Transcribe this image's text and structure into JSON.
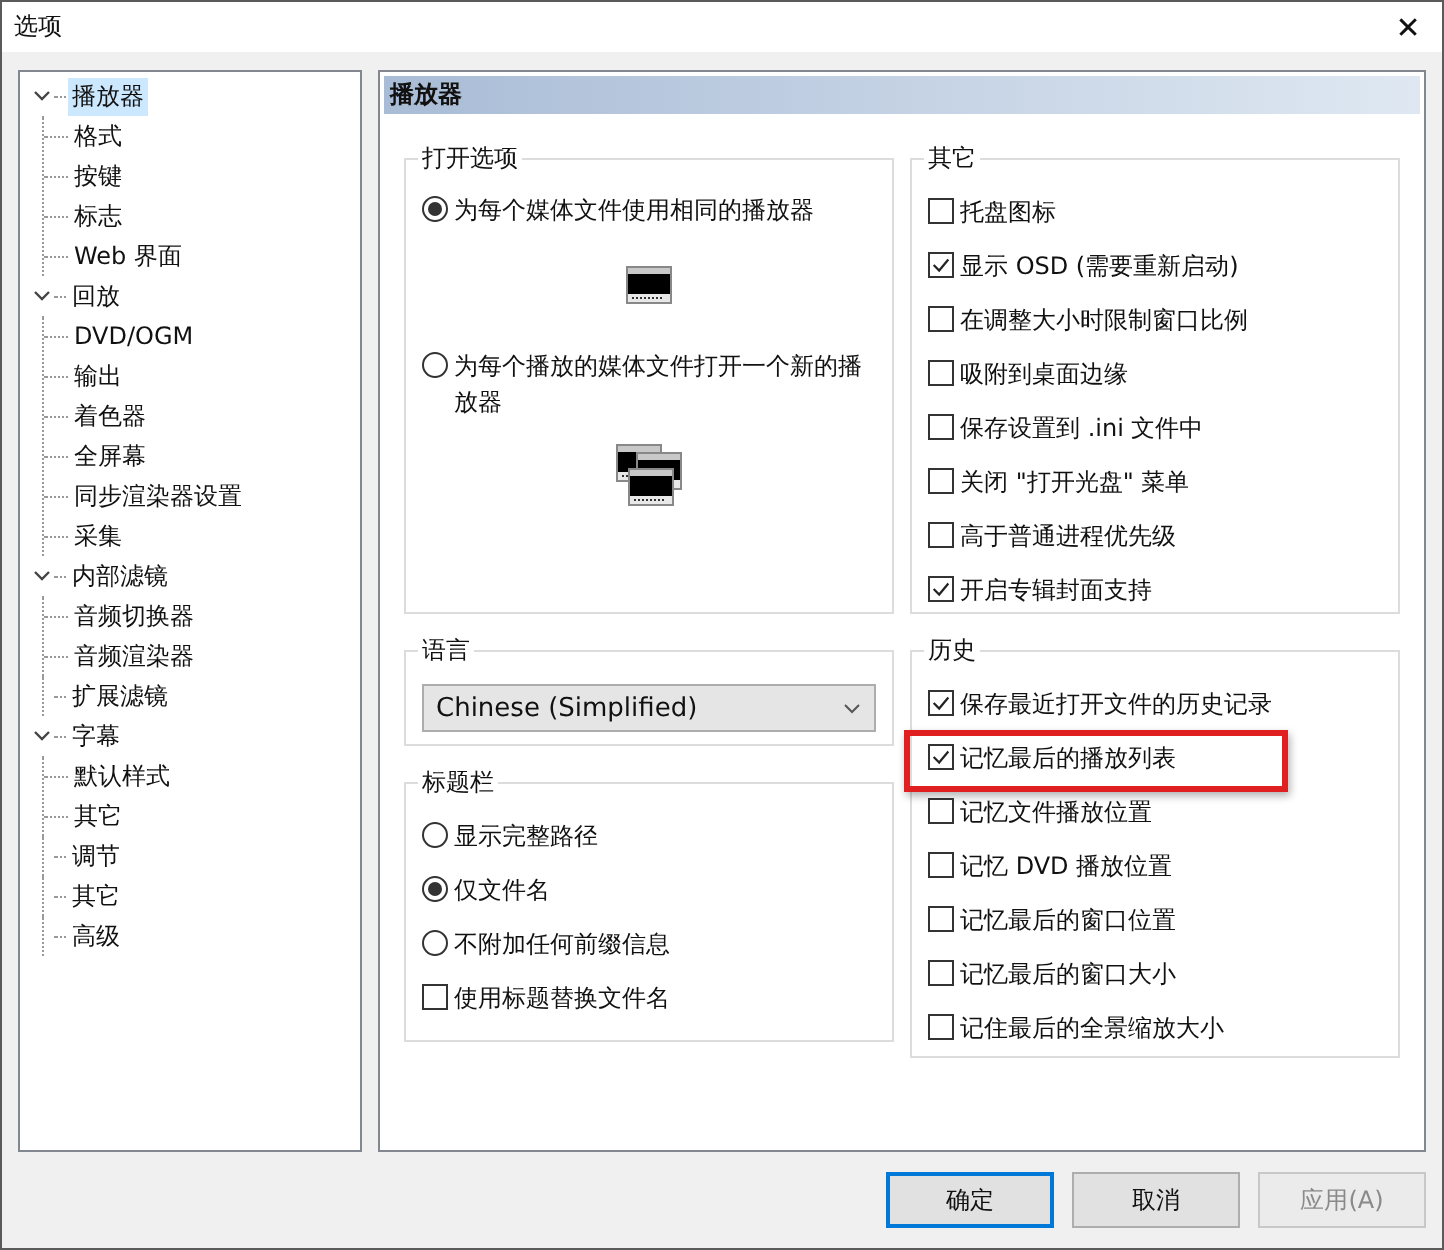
{
  "window": {
    "title": "选项",
    "close": "✕"
  },
  "tree": [
    {
      "label": "播放器",
      "selected": true,
      "expanded": true,
      "children": [
        {
          "label": "格式",
          "selected": false
        },
        {
          "label": "按键",
          "selected": false
        },
        {
          "label": "标志",
          "selected": false
        },
        {
          "label": "Web 界面",
          "selected": false
        }
      ]
    },
    {
      "label": "回放",
      "selected": false,
      "expanded": true,
      "children": [
        {
          "label": "DVD/OGM",
          "selected": false
        },
        {
          "label": "输出",
          "selected": false
        },
        {
          "label": "着色器",
          "selected": false
        },
        {
          "label": "全屏幕",
          "selected": false
        },
        {
          "label": "同步渲染器设置",
          "selected": false
        },
        {
          "label": "采集",
          "selected": false
        }
      ]
    },
    {
      "label": "内部滤镜",
      "selected": false,
      "expanded": true,
      "children": [
        {
          "label": "音频切换器",
          "selected": false
        },
        {
          "label": "音频渲染器",
          "selected": false
        }
      ]
    },
    {
      "label": "扩展滤镜",
      "selected": false
    },
    {
      "label": "字幕",
      "selected": false,
      "expanded": true,
      "children": [
        {
          "label": "默认样式",
          "selected": false
        },
        {
          "label": "其它",
          "selected": false
        }
      ]
    },
    {
      "label": "调节",
      "selected": false
    },
    {
      "label": "其它",
      "selected": false
    },
    {
      "label": "高级",
      "selected": false
    }
  ],
  "page_header": "播放器",
  "open_options": {
    "title": "打开选项",
    "options": [
      {
        "label": "为每个媒体文件使用相同的播放器",
        "selected": true,
        "kind": "single"
      },
      {
        "label": "为每个播放的媒体文件打开一个新的播放器",
        "selected": false,
        "kind": "multiple"
      }
    ]
  },
  "other": {
    "title": "其它",
    "items": [
      {
        "label": "托盘图标",
        "checked": false
      },
      {
        "label": "显示 OSD (需要重新启动)",
        "checked": true
      },
      {
        "label": "在调整大小时限制窗口比例",
        "checked": false
      },
      {
        "label": "吸附到桌面边缘",
        "checked": false
      },
      {
        "label": "保存设置到 .ini 文件中",
        "checked": false
      },
      {
        "label": "关闭 \"打开光盘\" 菜单",
        "checked": false
      },
      {
        "label": "高于普通进程优先级",
        "checked": false
      },
      {
        "label": "开启专辑封面支持",
        "checked": true
      }
    ]
  },
  "language": {
    "title": "语言",
    "value": "Chinese (Simplified)"
  },
  "title_bar": {
    "title": "标题栏",
    "options": [
      {
        "label": "显示完整路径",
        "selected": false
      },
      {
        "label": "仅文件名",
        "selected": true
      },
      {
        "label": "不附加任何前缀信息",
        "selected": false
      }
    ],
    "checkbox": {
      "label": "使用标题替换文件名",
      "checked": false
    }
  },
  "history": {
    "title": "历史",
    "items": [
      {
        "label": "保存最近打开文件的历史记录",
        "checked": true,
        "highlighted": false
      },
      {
        "label": "记忆最后的播放列表",
        "checked": true,
        "highlighted": true
      },
      {
        "label": "记忆文件播放位置",
        "checked": false,
        "highlighted": false
      },
      {
        "label": "记忆 DVD 播放位置",
        "checked": false,
        "highlighted": false
      },
      {
        "label": "记忆最后的窗口位置",
        "checked": false,
        "highlighted": false
      },
      {
        "label": "记忆最后的窗口大小",
        "checked": false,
        "highlighted": false
      },
      {
        "label": "记住最后的全景缩放大小",
        "checked": false,
        "highlighted": false
      }
    ]
  },
  "buttons": [
    {
      "label": "确定",
      "kind": "default",
      "disabled": false
    },
    {
      "label": "取消",
      "kind": "normal",
      "disabled": false
    },
    {
      "label": "应用(A)",
      "kind": "normal",
      "disabled": true
    }
  ]
}
